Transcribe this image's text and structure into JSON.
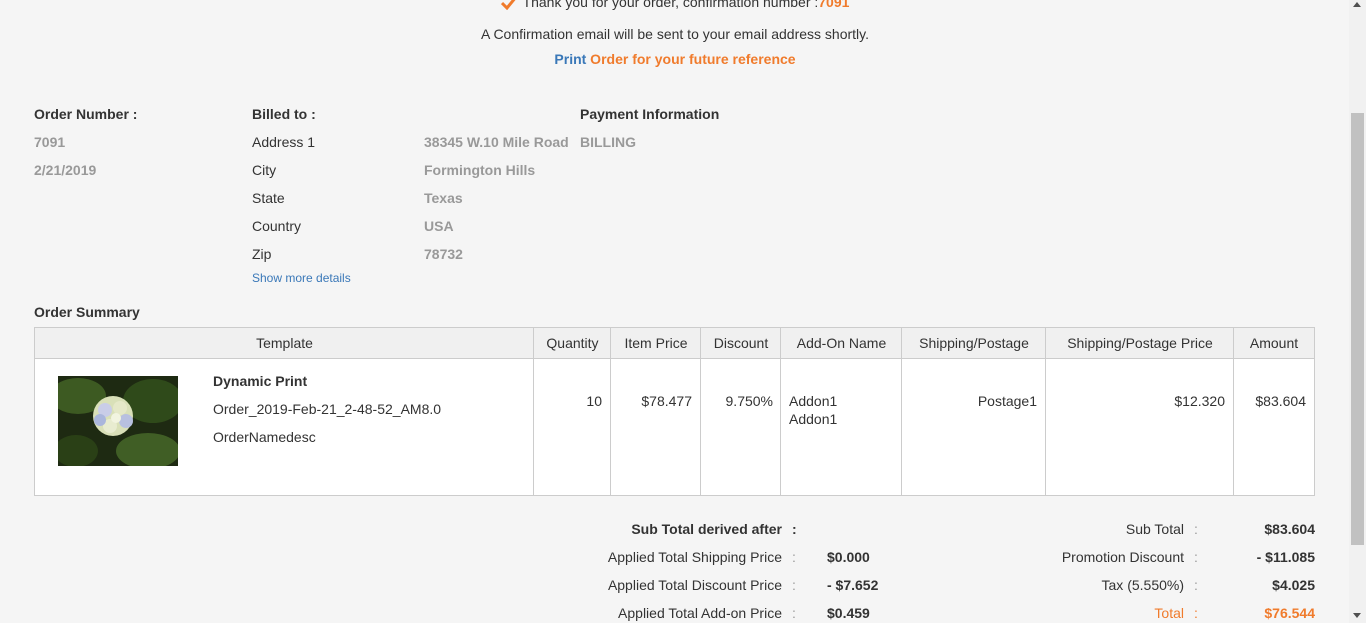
{
  "confirmation": {
    "thank_you": "Thank you for your order, confirmation number :",
    "number": "7091",
    "email_note": "A Confirmation email will be sent to your email address shortly.",
    "print_link": "Print",
    "print_rest": " Order for your future reference"
  },
  "order": {
    "heading": "Order Number :",
    "number": "7091",
    "date": "2/21/2019"
  },
  "billing": {
    "heading": "Billed to :",
    "fields": [
      {
        "label": "Address 1",
        "value": "38345 W.10 Mile Road"
      },
      {
        "label": "City",
        "value": "Formington Hills"
      },
      {
        "label": "State",
        "value": "Texas"
      },
      {
        "label": "Country",
        "value": "USA"
      },
      {
        "label": "Zip",
        "value": "78732"
      }
    ],
    "show_more": "Show more details"
  },
  "payment": {
    "heading": "Payment Information",
    "type": "BILLING"
  },
  "summary": {
    "heading": "Order Summary",
    "columns": [
      "Template",
      "Quantity",
      "Item Price",
      "Discount",
      "Add-On Name",
      "Shipping/Postage",
      "Shipping/Postage Price",
      "Amount"
    ],
    "rows": [
      {
        "product_name": "Dynamic Print",
        "order_name": "Order_2019-Feb-21_2-48-52_AM8.0",
        "description": "OrderNamedesc",
        "quantity": "10",
        "item_price": "$78.477",
        "discount": "9.750%",
        "addons": [
          "Addon1",
          "Addon1"
        ],
        "shipping": "Postage1",
        "shipping_price": "$12.320",
        "amount": "$83.604"
      }
    ]
  },
  "totals_left": {
    "heading": "Sub Total derived after",
    "rows": [
      {
        "label": "Applied Total Shipping Price",
        "value": "$0.000"
      },
      {
        "label": "Applied Total Discount Price",
        "value": "- $7.652"
      },
      {
        "label": "Applied Total Add-on Price",
        "value": "$0.459"
      }
    ]
  },
  "totals_right": {
    "rows": [
      {
        "label": "Sub Total",
        "value": "$83.604"
      },
      {
        "label": "Promotion Discount",
        "value": "- $11.085"
      },
      {
        "label": "Tax (5.550%)",
        "value": "$4.025"
      }
    ],
    "total_label": "Total",
    "total_value": "$76.544"
  },
  "colors": {
    "accent": "#f07b2c",
    "link": "#3a78b8"
  },
  "icons": {
    "check": "check-icon"
  }
}
